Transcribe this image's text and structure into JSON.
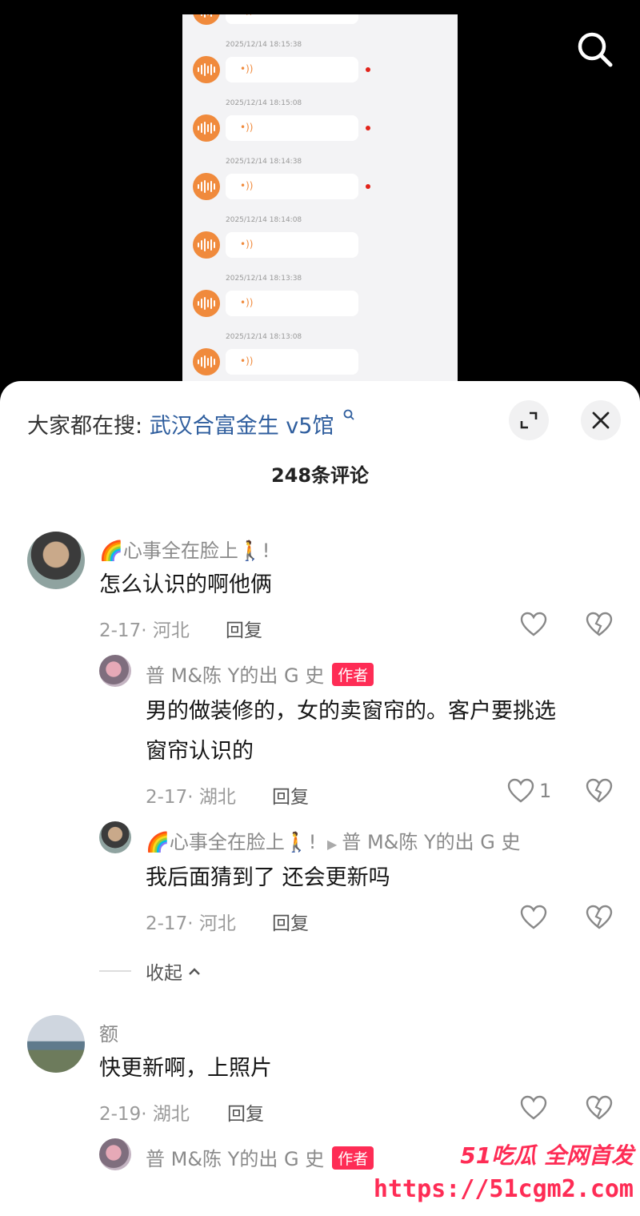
{
  "video": {
    "voice_messages": [
      {
        "time": "",
        "unread": true
      },
      {
        "time": "2025/12/14 18:15:38",
        "unread": true
      },
      {
        "time": "2025/12/14 18:15:08",
        "unread": true
      },
      {
        "time": "2025/12/14 18:14:38",
        "unread": true
      },
      {
        "time": "2025/12/14 18:14:08",
        "unread": false
      },
      {
        "time": "2025/12/14 18:13:38",
        "unread": false
      },
      {
        "time": "2025/12/14 18:13:08",
        "unread": false
      }
    ],
    "wave_glyph": "•))"
  },
  "trend": {
    "prefix": "大家都在搜:",
    "keyword": "武汉合富金生 v5馆"
  },
  "comment_count": "248条评论",
  "comments": [
    {
      "nick": "🌈心事全在脸上🚶!",
      "text": "怎么认识的啊他俩",
      "date": "2-17· 河北",
      "reply_label": "回复",
      "replies": [
        {
          "nick": "普 M&陈 Y的出 G 史",
          "author_tag": "作者",
          "text_line1": "男的做装修的，女的卖窗帘的。客户要挑选",
          "text_line2": "窗帘认识的",
          "date": "2-17· 湖北",
          "reply_label": "回复",
          "likes": "1"
        },
        {
          "nick": "🌈心事全在脸上🚶!",
          "reply_to": "普 M&陈 Y的出 G 史",
          "text": "我后面猜到了 还会更新吗",
          "date": "2-17· 河北",
          "reply_label": "回复"
        }
      ],
      "collapse_label": "收起"
    },
    {
      "nick": "额",
      "text": "快更新啊，上照片",
      "date": "2-19· 湖北",
      "reply_label": "回复",
      "replies": [
        {
          "nick": "普 M&陈 Y的出 G 史",
          "author_tag": "作者"
        }
      ]
    }
  ],
  "watermark": {
    "line1": "51吃瓜 全网首发",
    "line2": "https://51cgm2.com"
  },
  "colors": {
    "accent": "#fe2c55",
    "keyword": "#2f5e9e",
    "voice": "#f08a3c"
  }
}
